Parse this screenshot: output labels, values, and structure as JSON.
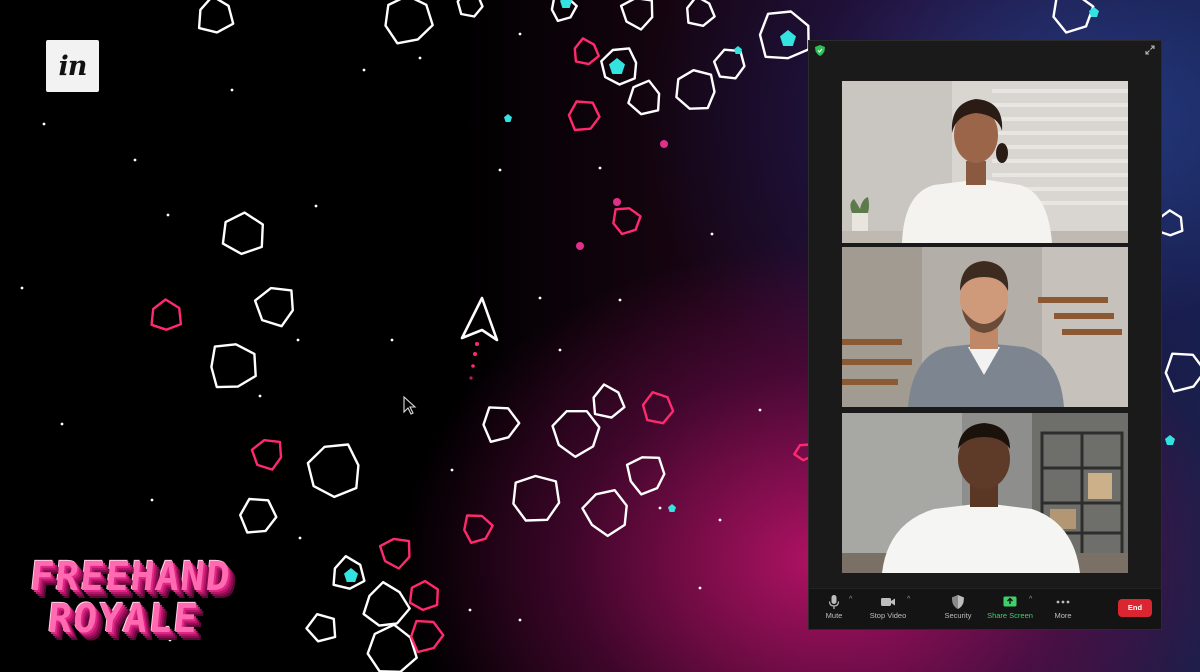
{
  "brand": {
    "logo_text": "in",
    "logo_name": "InVision"
  },
  "game": {
    "title_line1": "FREEHAND",
    "title_line2": "ROYALE"
  },
  "meeting": {
    "participants": [
      {
        "description": "woman in white t-shirt"
      },
      {
        "description": "man in grey shirt"
      },
      {
        "description": "man in white t-shirt"
      }
    ],
    "toolbar": {
      "mute_label": "Mute",
      "video_label": "Stop Video",
      "security_label": "Security",
      "share_label": "Share Screen",
      "more_label": "More",
      "end_label": "End"
    }
  },
  "colors": {
    "asteroid_white": "#ffffff",
    "asteroid_pink": "#ff2a6d",
    "gem_cyan": "#33e3e0",
    "share_green": "#3fd06a",
    "end_red": "#d92630"
  }
}
